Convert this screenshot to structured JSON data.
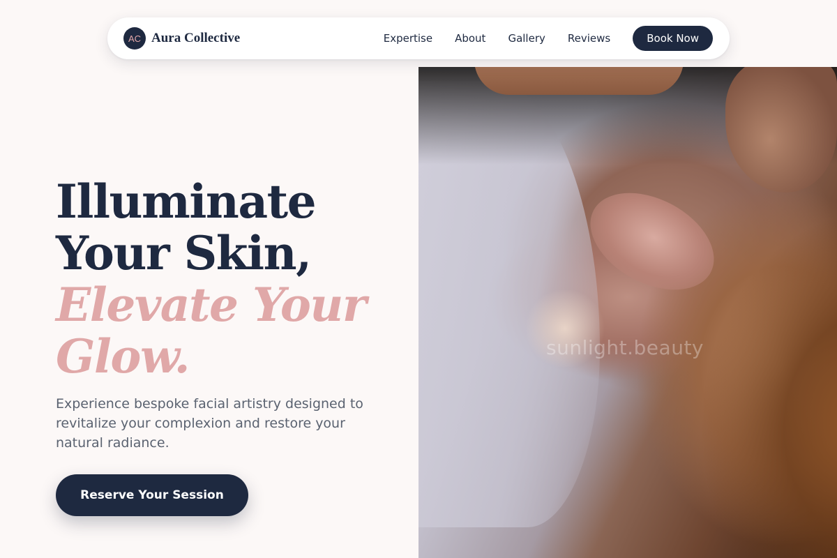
{
  "nav": {
    "logo_initials": "AC",
    "brand_name": "Aura Collective",
    "links": [
      "Expertise",
      "About",
      "Gallery",
      "Reviews"
    ],
    "cta_label": "Book Now"
  },
  "hero": {
    "headline_dark": [
      "Illuminate",
      "Your Skin,"
    ],
    "headline_accent": [
      "Elevate Your",
      "Glow."
    ],
    "subtext": "Experience bespoke facial artistry designed to revitalize your complexion and restore your natural radiance.",
    "cta_label": "Reserve Your Session",
    "image_watermark": "sunlight.beauty"
  },
  "colors": {
    "navy": "#1e2940",
    "accent_pink": "#e0a8a8",
    "background": "#fcf8f7",
    "body_text": "#5a6270"
  },
  "icons": {
    "logo": "circle-monogram"
  }
}
